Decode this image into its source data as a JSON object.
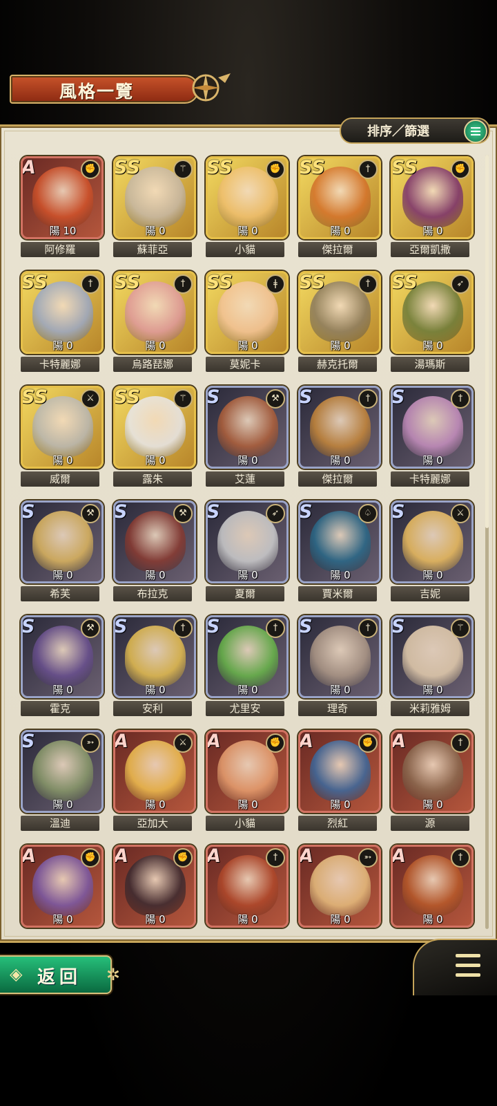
{
  "header": {
    "title": "風格一覽"
  },
  "toolbar": {
    "sort_filter_label": "排序／篩選"
  },
  "footer": {
    "back_label": "返回"
  },
  "colors": {
    "ss_frame": "#e6c04a",
    "s_frame": "#9aa4c8",
    "a_frame": "#d27262",
    "button_green": "#26bf7a"
  },
  "styles": [
    {
      "rank": "A",
      "name": "阿修羅",
      "level": "陽 10",
      "weapon": "gauntlet-icon",
      "portrait": "#d0522a"
    },
    {
      "rank": "SS",
      "name": "蘇菲亞",
      "level": "陽 0",
      "weapon": "staff-icon",
      "portrait": "#c6b8a8"
    },
    {
      "rank": "SS",
      "name": "小貓",
      "level": "陽 0",
      "weapon": "gauntlet-icon",
      "portrait": "#f0c070"
    },
    {
      "rank": "SS",
      "name": "傑拉爾",
      "level": "陽 0",
      "weapon": "sword-icon",
      "portrait": "#d4702a"
    },
    {
      "rank": "SS",
      "name": "亞爾凱撒",
      "level": "陽 0",
      "weapon": "gauntlet-icon",
      "portrait": "#7a3070"
    },
    {
      "rank": "SS",
      "name": "卡特麗娜",
      "level": "陽 0",
      "weapon": "sword-icon",
      "portrait": "#9aa8c8"
    },
    {
      "rank": "SS",
      "name": "烏路琵娜",
      "level": "陽 0",
      "weapon": "sword-icon",
      "portrait": "#e09aa0"
    },
    {
      "rank": "SS",
      "name": "莫妮卡",
      "level": "陽 0",
      "weapon": "rapier-icon",
      "portrait": "#f4c49a"
    },
    {
      "rank": "SS",
      "name": "赫克托爾",
      "level": "陽 0",
      "weapon": "sword-icon",
      "portrait": "#8a7a60"
    },
    {
      "rank": "SS",
      "name": "湯瑪斯",
      "level": "陽 0",
      "weapon": "spear-icon",
      "portrait": "#6a7a3a"
    },
    {
      "rank": "SS",
      "name": "威爾",
      "level": "陽 0",
      "weapon": "greatsword-icon",
      "portrait": "#b8b8b8"
    },
    {
      "rank": "SS",
      "name": "露朱",
      "level": "陽 0",
      "weapon": "staff-icon",
      "portrait": "#e8e8ee"
    },
    {
      "rank": "S",
      "name": "艾蓮",
      "level": "陽 0",
      "weapon": "axe-icon",
      "portrait": "#b0603a"
    },
    {
      "rank": "S",
      "name": "傑拉爾",
      "level": "陽 0",
      "weapon": "sword-icon",
      "portrait": "#c8883a"
    },
    {
      "rank": "S",
      "name": "卡特麗娜",
      "level": "陽 0",
      "weapon": "sword-icon",
      "portrait": "#c890c0"
    },
    {
      "rank": "S",
      "name": "希芙",
      "level": "陽 0",
      "weapon": "axe-icon",
      "portrait": "#e0b860"
    },
    {
      "rank": "S",
      "name": "布拉克",
      "level": "陽 0",
      "weapon": "axe-icon",
      "portrait": "#8a3a30"
    },
    {
      "rank": "S",
      "name": "夏爾",
      "level": "陽 0",
      "weapon": "spear-icon",
      "portrait": "#d0d0d0"
    },
    {
      "rank": "S",
      "name": "賈米爾",
      "level": "陽 0",
      "weapon": "dagger-icon",
      "portrait": "#2a6a8a"
    },
    {
      "rank": "S",
      "name": "吉妮",
      "level": "陽 0",
      "weapon": "greatsword-icon",
      "portrait": "#f0c060"
    },
    {
      "rank": "S",
      "name": "霍克",
      "level": "陽 0",
      "weapon": "axe-icon",
      "portrait": "#6a5090"
    },
    {
      "rank": "S",
      "name": "安利",
      "level": "陽 0",
      "weapon": "sword-icon",
      "portrait": "#e8c050"
    },
    {
      "rank": "S",
      "name": "尤里安",
      "level": "陽 0",
      "weapon": "sword-icon",
      "portrait": "#6ab84a"
    },
    {
      "rank": "S",
      "name": "理奇",
      "level": "陽 0",
      "weapon": "sword-icon",
      "portrait": "#b09a88"
    },
    {
      "rank": "S",
      "name": "米莉雅姆",
      "level": "陽 0",
      "weapon": "staff-icon",
      "portrait": "#e8d0b0"
    },
    {
      "rank": "S",
      "name": "溫迪",
      "level": "陽 0",
      "weapon": "bow-icon",
      "portrait": "#8a9a6a"
    },
    {
      "rank": "A",
      "name": "亞加大",
      "level": "陽 0",
      "weapon": "greatsword-icon",
      "portrait": "#f0c050"
    },
    {
      "rank": "A",
      "name": "小貓",
      "level": "陽 0",
      "weapon": "gauntlet-icon",
      "portrait": "#e8a070"
    },
    {
      "rank": "A",
      "name": "烈紅",
      "level": "陽 0",
      "weapon": "gauntlet-icon",
      "portrait": "#3a6aa0"
    },
    {
      "rank": "A",
      "name": "源",
      "level": "陽 0",
      "weapon": "sword-icon",
      "portrait": "#8a6a50"
    },
    {
      "rank": "A",
      "name": "",
      "level": "陽 0",
      "weapon": "gauntlet-icon",
      "portrait": "#7a5aa8"
    },
    {
      "rank": "A",
      "name": "",
      "level": "陽 0",
      "weapon": "gauntlet-icon",
      "portrait": "#3a2a30"
    },
    {
      "rank": "A",
      "name": "",
      "level": "陽 0",
      "weapon": "sword-icon",
      "portrait": "#b0482a"
    },
    {
      "rank": "A",
      "name": "",
      "level": "陽 0",
      "weapon": "bow-icon",
      "portrait": "#e8c080"
    },
    {
      "rank": "A",
      "name": "",
      "level": "陽 0",
      "weapon": "sword-icon",
      "portrait": "#b85a2a"
    }
  ]
}
